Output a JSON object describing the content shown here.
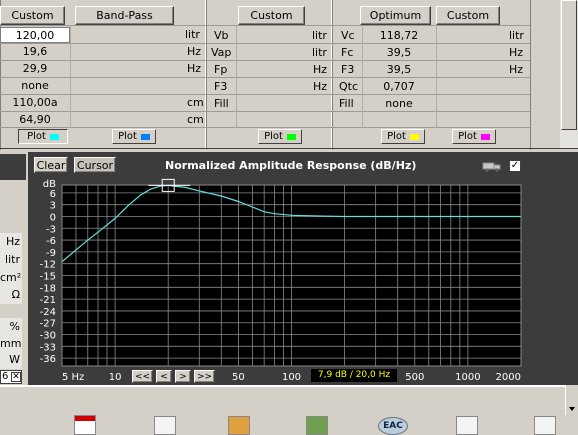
{
  "top": {
    "col1": {
      "header_buttons": [
        "Custom",
        "Band-Pass"
      ],
      "values": [
        "120,00",
        "19,6",
        "29,9",
        "none",
        "110,00a",
        "64,90"
      ],
      "units": [
        "litr",
        "Hz",
        "Hz",
        "",
        "cm",
        "cm"
      ],
      "plot_label": "Plot",
      "plot2_label": "Plot"
    },
    "col2": {
      "header_button": "Custom",
      "labels": [
        "Vb",
        "Vap",
        "Fp",
        "F3",
        "Fill"
      ],
      "units": [
        "litr",
        "litr",
        "Hz",
        "Hz"
      ],
      "plot_label": "Plot"
    },
    "col3": {
      "header_buttons": [
        "Optimum",
        "Custom"
      ],
      "labels": [
        "Vc",
        "Fc",
        "F3",
        "Qtc",
        "Fill"
      ],
      "values": [
        "118,72",
        "39,5",
        "39,5",
        "0,707",
        "none"
      ],
      "units": [
        "litr",
        "Hz",
        "Hz"
      ],
      "plot_label": "Plot",
      "plot2_label": "Plot"
    },
    "swatch_colors": [
      "#00ffff",
      "#0080ff",
      "#00ff00",
      "#ffff00",
      "#ff00ff"
    ]
  },
  "left_units": [
    "Hz",
    "litr",
    "cm²",
    "Ω",
    "%",
    "mm",
    "W"
  ],
  "graph": {
    "clear_label": "Clear",
    "cursor_label": "Cursor",
    "title": "Normalized Amplitude Response (dB/Hz)",
    "readout": "7,9 dB / 20,0 Hz",
    "nav": [
      "<<",
      "<",
      ">",
      ">>"
    ]
  },
  "chart_data": {
    "type": "line",
    "title": "Normalized Amplitude Response (dB/Hz)",
    "xscale": "log",
    "xlim": [
      5,
      2000
    ],
    "ylim": [
      -38,
      8
    ],
    "yticks": [
      6,
      3,
      0,
      -3,
      -6,
      -9,
      -12,
      -15,
      -18,
      -21,
      -24,
      -27,
      -30,
      -33,
      -36
    ],
    "ytick_labels": [
      "6",
      "3",
      "0",
      "-3",
      "-6",
      "-9",
      "-12",
      "-15",
      "-18",
      "-21",
      "-24",
      "-27",
      "-30",
      "-33",
      "-36"
    ],
    "xticks": [
      5,
      10,
      50,
      100,
      500,
      1000,
      2000
    ],
    "xtick_labels": [
      "5 Hz",
      "10",
      "50",
      "100",
      "500",
      "1000",
      "2000"
    ],
    "yunit": "dB",
    "grid": true,
    "series": [
      {
        "color": "#66dddd",
        "x": [
          5,
          6,
          7,
          8,
          10,
          12,
          14,
          16,
          18,
          20,
          25,
          30,
          40,
          50,
          60,
          70,
          80,
          100,
          150,
          200,
          500,
          2000
        ],
        "y": [
          -11.5,
          -8.5,
          -6,
          -4,
          -0.5,
          3,
          5.5,
          7,
          7.7,
          7.9,
          7.4,
          6.5,
          5.2,
          3.8,
          2.4,
          1.2,
          0.7,
          0.3,
          0.1,
          0,
          0,
          0
        ]
      }
    ],
    "cursor": {
      "x": 20,
      "y": 7.9
    }
  }
}
